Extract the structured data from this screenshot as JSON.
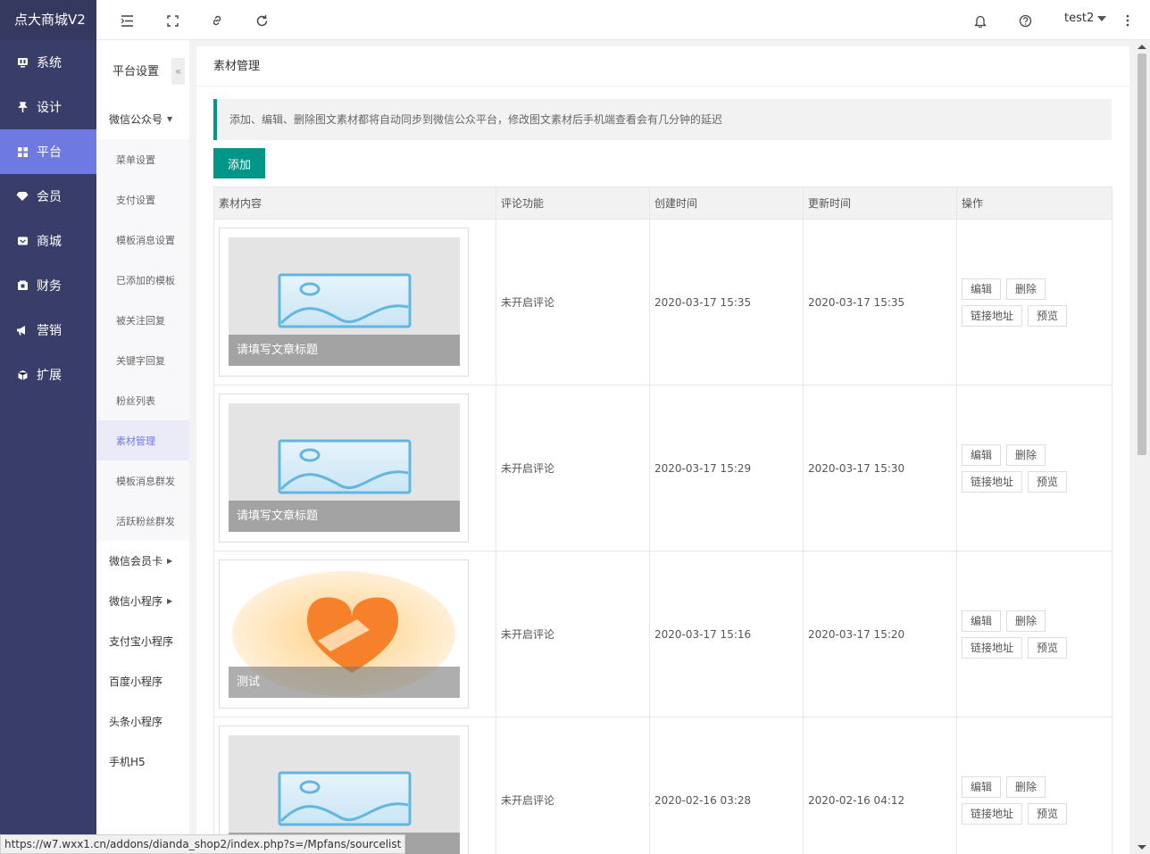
{
  "app": {
    "title": "点大商城V2"
  },
  "sidebar": {
    "items": [
      {
        "label": "系统",
        "icon": "monitor-icon"
      },
      {
        "label": "设计",
        "icon": "pin-icon"
      },
      {
        "label": "平台",
        "icon": "grid-icon",
        "active": true
      },
      {
        "label": "会员",
        "icon": "diamond-icon"
      },
      {
        "label": "商城",
        "icon": "mail-icon"
      },
      {
        "label": "财务",
        "icon": "wallet-icon"
      },
      {
        "label": "营销",
        "icon": "megaphone-icon"
      },
      {
        "label": "扩展",
        "icon": "cube-icon"
      }
    ]
  },
  "header": {
    "user": "test2"
  },
  "subnav": {
    "title": "平台设置",
    "collapse_glyph": "«",
    "group_expanded": "微信公众号",
    "children": [
      "菜单设置",
      "支付设置",
      "模板消息设置",
      "已添加的模板",
      "被关注回复",
      "关键字回复",
      "粉丝列表",
      "素材管理",
      "模板消息群发",
      "活跃粉丝群发"
    ],
    "active_child": 7,
    "groups": [
      {
        "label": "微信会员卡",
        "arrow": true
      },
      {
        "label": "微信小程序",
        "arrow": true
      },
      {
        "label": "支付宝小程序",
        "arrow": false
      },
      {
        "label": "百度小程序",
        "arrow": false
      },
      {
        "label": "头条小程序",
        "arrow": false
      },
      {
        "label": "手机H5",
        "arrow": false
      }
    ]
  },
  "main": {
    "title": "素材管理",
    "notice": "添加、编辑、删除图文素材都将自动同步到微信公众平台，修改图文素材后手机端查看会有几分钟的延迟",
    "add_label": "添加",
    "columns": [
      "素材内容",
      "评论功能",
      "创建时间",
      "更新时间",
      "操作"
    ],
    "actions": {
      "edit": "编辑",
      "delete": "删除",
      "link": "链接地址",
      "preview": "预览"
    },
    "rows": [
      {
        "caption": "请填写文章标题",
        "cover": "placeholder-image",
        "comment": "未开启评论",
        "created": "2020-03-17 15:35",
        "updated": "2020-03-17 15:35"
      },
      {
        "caption": "请填写文章标题",
        "cover": "placeholder-image",
        "comment": "未开启评论",
        "created": "2020-03-17 15:29",
        "updated": "2020-03-17 15:30"
      },
      {
        "caption": "测试",
        "cover": "orange-logo-image",
        "comment": "未开启评论",
        "created": "2020-03-17 15:16",
        "updated": "2020-03-17 15:20"
      },
      {
        "caption": "",
        "cover": "placeholder-image",
        "comment": "未开启评论",
        "created": "2020-02-16 03:28",
        "updated": "2020-02-16 04:12"
      }
    ]
  },
  "status_url": "https://w7.wxx1.cn/addons/dianda_shop2/index.php?s=/Mpfans/sourcelist",
  "colors": {
    "sidebar": "#393d6a",
    "active": "#6f79e2",
    "primary": "#009688"
  }
}
